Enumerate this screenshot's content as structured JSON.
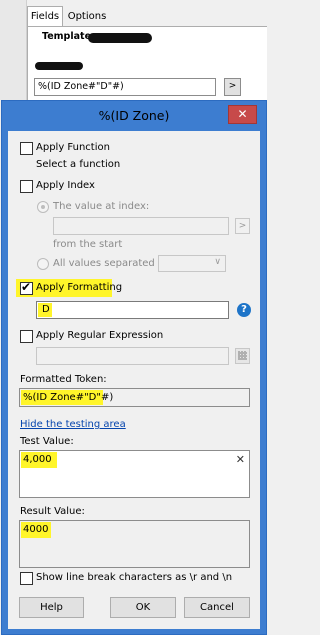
{
  "background_window": {
    "tabs": [
      {
        "label": "Fields"
      },
      {
        "label": "Options"
      }
    ],
    "template_label": "Template:",
    "pattern_value": "%(ID Zone#\"D\"#)",
    "pattern_button": ">"
  },
  "dialog": {
    "title": "%(ID Zone)",
    "close_glyph": "✕",
    "apply_function": {
      "label": "Apply Function",
      "checked": false,
      "hint": "Select a function"
    },
    "apply_index": {
      "label": "Apply Index",
      "checked": false,
      "value_at_index_label": "The value at index:",
      "index_value": "",
      "from_the_start": "from the  start",
      "all_values_label": "All values separated by:",
      "separator_value": "",
      "arrow": ">",
      "dropdown_glyph": "∨"
    },
    "apply_formatting": {
      "label": "Apply Formatting",
      "checked": true,
      "value": "D",
      "help_glyph": "?"
    },
    "apply_regex": {
      "label": "Apply Regular Expression",
      "checked": false,
      "value": ""
    },
    "formatted_token": {
      "label": "Formatted Token:",
      "value": "%(ID Zone#\"D\"#)"
    },
    "hide_testing_link": "Hide the testing area",
    "test_value": {
      "label": "Test Value:",
      "value": "4,000",
      "clear_glyph": "✕"
    },
    "result_value": {
      "label": "Result Value:",
      "value": "4000"
    },
    "show_line_breaks": {
      "label": "Show line break characters as \\r and \\n",
      "checked": false
    },
    "buttons": {
      "help": "Help",
      "ok": "OK",
      "cancel": "Cancel"
    }
  },
  "colors": {
    "highlight": "#fff52a",
    "title_bar": "#3d7dd0",
    "close_button": "#c74a4a",
    "link": "#0645ad",
    "help_icon": "#1e74c8"
  }
}
